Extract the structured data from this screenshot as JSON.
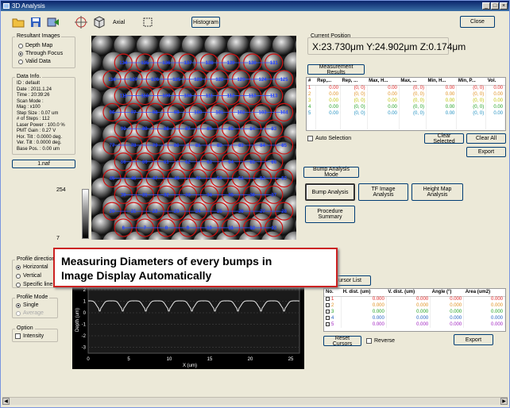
{
  "window": {
    "title": "3D Analysis"
  },
  "toolbar": {
    "axial_label": "Axial",
    "histogram_label": "Histogram",
    "close_label": "Close"
  },
  "resultant_images": {
    "title": "Resultant Images",
    "options": [
      "Depth Map",
      "Through Focus",
      "Valid Data"
    ],
    "selected": "Through Focus"
  },
  "data_info": {
    "title": "Data Info.",
    "lines": [
      "ID : default",
      "Date : 2011.1.24",
      "Time : 20:39:26",
      "Scan Mode :",
      "Mag : x100",
      "Step Size : 0.07 um",
      "# of Steps : 112",
      "Laser Power : 100.0 %",
      "PMT Gain : 0.27 V",
      "Hor. Tilt : 0.0000 deg.",
      "Ver. Tilt : 0.0000 deg.",
      "Base Pos. : 0.00 um"
    ],
    "file": "1.naf"
  },
  "colorbar": {
    "max": "254",
    "min": "7"
  },
  "current_position": {
    "title": "Current Position",
    "value": "X:23.730μm Y:24.902μm Z:0.174μm"
  },
  "measurement": {
    "button": "Measurement Results",
    "headers": [
      "#",
      "Rep,...",
      "Rep, ...",
      "Max, H...",
      "Max, ...",
      "Min, H...",
      "Min, P...",
      "Vol."
    ],
    "rows": [
      {
        "n": "1",
        "a": "0.00",
        "b": "(0, 0)",
        "c": "0.00",
        "d": "(0, 0)",
        "e": "0.00",
        "f": "(0, 0)",
        "g": "0.00",
        "color": "#e02020"
      },
      {
        "n": "2",
        "a": "0.00",
        "b": "(0, 0)",
        "c": "0.00",
        "d": "(0, 0)",
        "e": "0.00",
        "f": "(0, 0)",
        "g": "0.00",
        "color": "#e09020"
      },
      {
        "n": "3",
        "a": "0.00",
        "b": "(0, 0)",
        "c": "0.00",
        "d": "(0, 0)",
        "e": "0.00",
        "f": "(0, 0)",
        "g": "0.00",
        "color": "#c0c000"
      },
      {
        "n": "4",
        "a": "0.00",
        "b": "(0, 0)",
        "c": "0.00",
        "d": "(0, 0)",
        "e": "0.00",
        "f": "(0, 0)",
        "g": "0.00",
        "color": "#20a020"
      },
      {
        "n": "5",
        "a": "0.00",
        "b": "(0, 0)",
        "c": "0.00",
        "d": "(0, 0)",
        "e": "0.00",
        "f": "(0, 0)",
        "g": "0.00",
        "color": "#2090c0"
      }
    ],
    "auto_selection": "Auto Selection",
    "clear_selected": "Clear Selected",
    "clear_all": "Clear All",
    "export": "Export"
  },
  "bump": {
    "mode_button": "Bump Analysis Mode",
    "bump_analysis": "Bump Analysis",
    "tf_image": "TF Image Analysis",
    "height_map": "Height Map Analysis",
    "procedure_summary": "Procedure Summary"
  },
  "profile_direction": {
    "title": "Profile direction",
    "options": [
      "Horizontal",
      "Vertical",
      "Specific line"
    ],
    "selected": "Horizontal"
  },
  "profile_mode": {
    "title": "Profile Mode",
    "options": [
      "Single",
      "Average"
    ],
    "selected": "Single"
  },
  "option": {
    "title": "Option",
    "intensity": "Intensity"
  },
  "profile_plot": {
    "ylabel": "Depth (um)",
    "xlabel": "X (um)",
    "yticks": [
      "2",
      "1",
      "0",
      "-1",
      "-2",
      "-3"
    ],
    "xticks": [
      "0",
      "5",
      "10",
      "15",
      "20",
      "25"
    ]
  },
  "cursor": {
    "list_button": "Cursor List",
    "headers": [
      "No.",
      "H. dist. (um)",
      "V. dist. (um)",
      "Angle (°)",
      "Area (um2)"
    ],
    "rows": [
      {
        "n": "1",
        "h": "0.000",
        "v": "0.000",
        "a": "0.000",
        "ar": "0.000",
        "color": "#e02020"
      },
      {
        "n": "2",
        "h": "0.000",
        "v": "0.000",
        "a": "0.000",
        "ar": "0.000",
        "color": "#e09020"
      },
      {
        "n": "3",
        "h": "0.000",
        "v": "0.000",
        "a": "0.000",
        "ar": "0.000",
        "color": "#20a020"
      },
      {
        "n": "4",
        "h": "0.000",
        "v": "0.000",
        "a": "0.000",
        "ar": "0.000",
        "color": "#2060c0"
      },
      {
        "n": "5",
        "h": "0.000",
        "v": "0.000",
        "a": "0.000",
        "ar": "0.000",
        "color": "#a020c0"
      }
    ],
    "reset": "Reset Cursors",
    "reverse": "Reverse",
    "export": "Export"
  },
  "callout": {
    "line1": "Measuring Diameters of every bumps in",
    "line2": "Image Display Automatically"
  },
  "bump_labels": {
    "r0": [
      "134",
      "135",
      "136",
      "137",
      "138",
      "139",
      "130",
      "131"
    ],
    "r1": [
      "118",
      "127",
      "126",
      "125",
      "123",
      "122",
      "123",
      "124",
      "125"
    ],
    "r2": [
      "111",
      "110",
      "109",
      "108",
      "111",
      "112",
      "113",
      "113"
    ],
    "r3": [
      "96",
      "97",
      "98",
      "99",
      "100",
      "101",
      "102",
      "103",
      "104"
    ],
    "r4": [
      "90",
      "89",
      "88",
      "87",
      "86",
      "85",
      "84",
      "83"
    ],
    "r5": [
      "77",
      "78",
      "79",
      "80",
      "81",
      "82",
      "83",
      "84",
      "85"
    ],
    "r6": [
      "66",
      "60",
      "61",
      "62",
      "63",
      "64",
      "65",
      "66"
    ],
    "r7": [
      "45",
      "46",
      "47",
      "48",
      "49",
      "50",
      "51",
      "52",
      "53"
    ],
    "r8": [
      "30",
      "31",
      "32",
      "33",
      "34",
      "35",
      "36",
      "37"
    ],
    "r9": [
      "20",
      "21",
      "22",
      "23",
      "24",
      "25",
      "26",
      "27",
      "28"
    ],
    "r10": [
      "6",
      "7",
      "8",
      "9",
      "10",
      "11",
      "12",
      "13"
    ]
  },
  "colors": {
    "title_bar": "#0a246a",
    "circle": "#d01010",
    "label": "#2040ff",
    "callout_border": "#cc2222"
  }
}
